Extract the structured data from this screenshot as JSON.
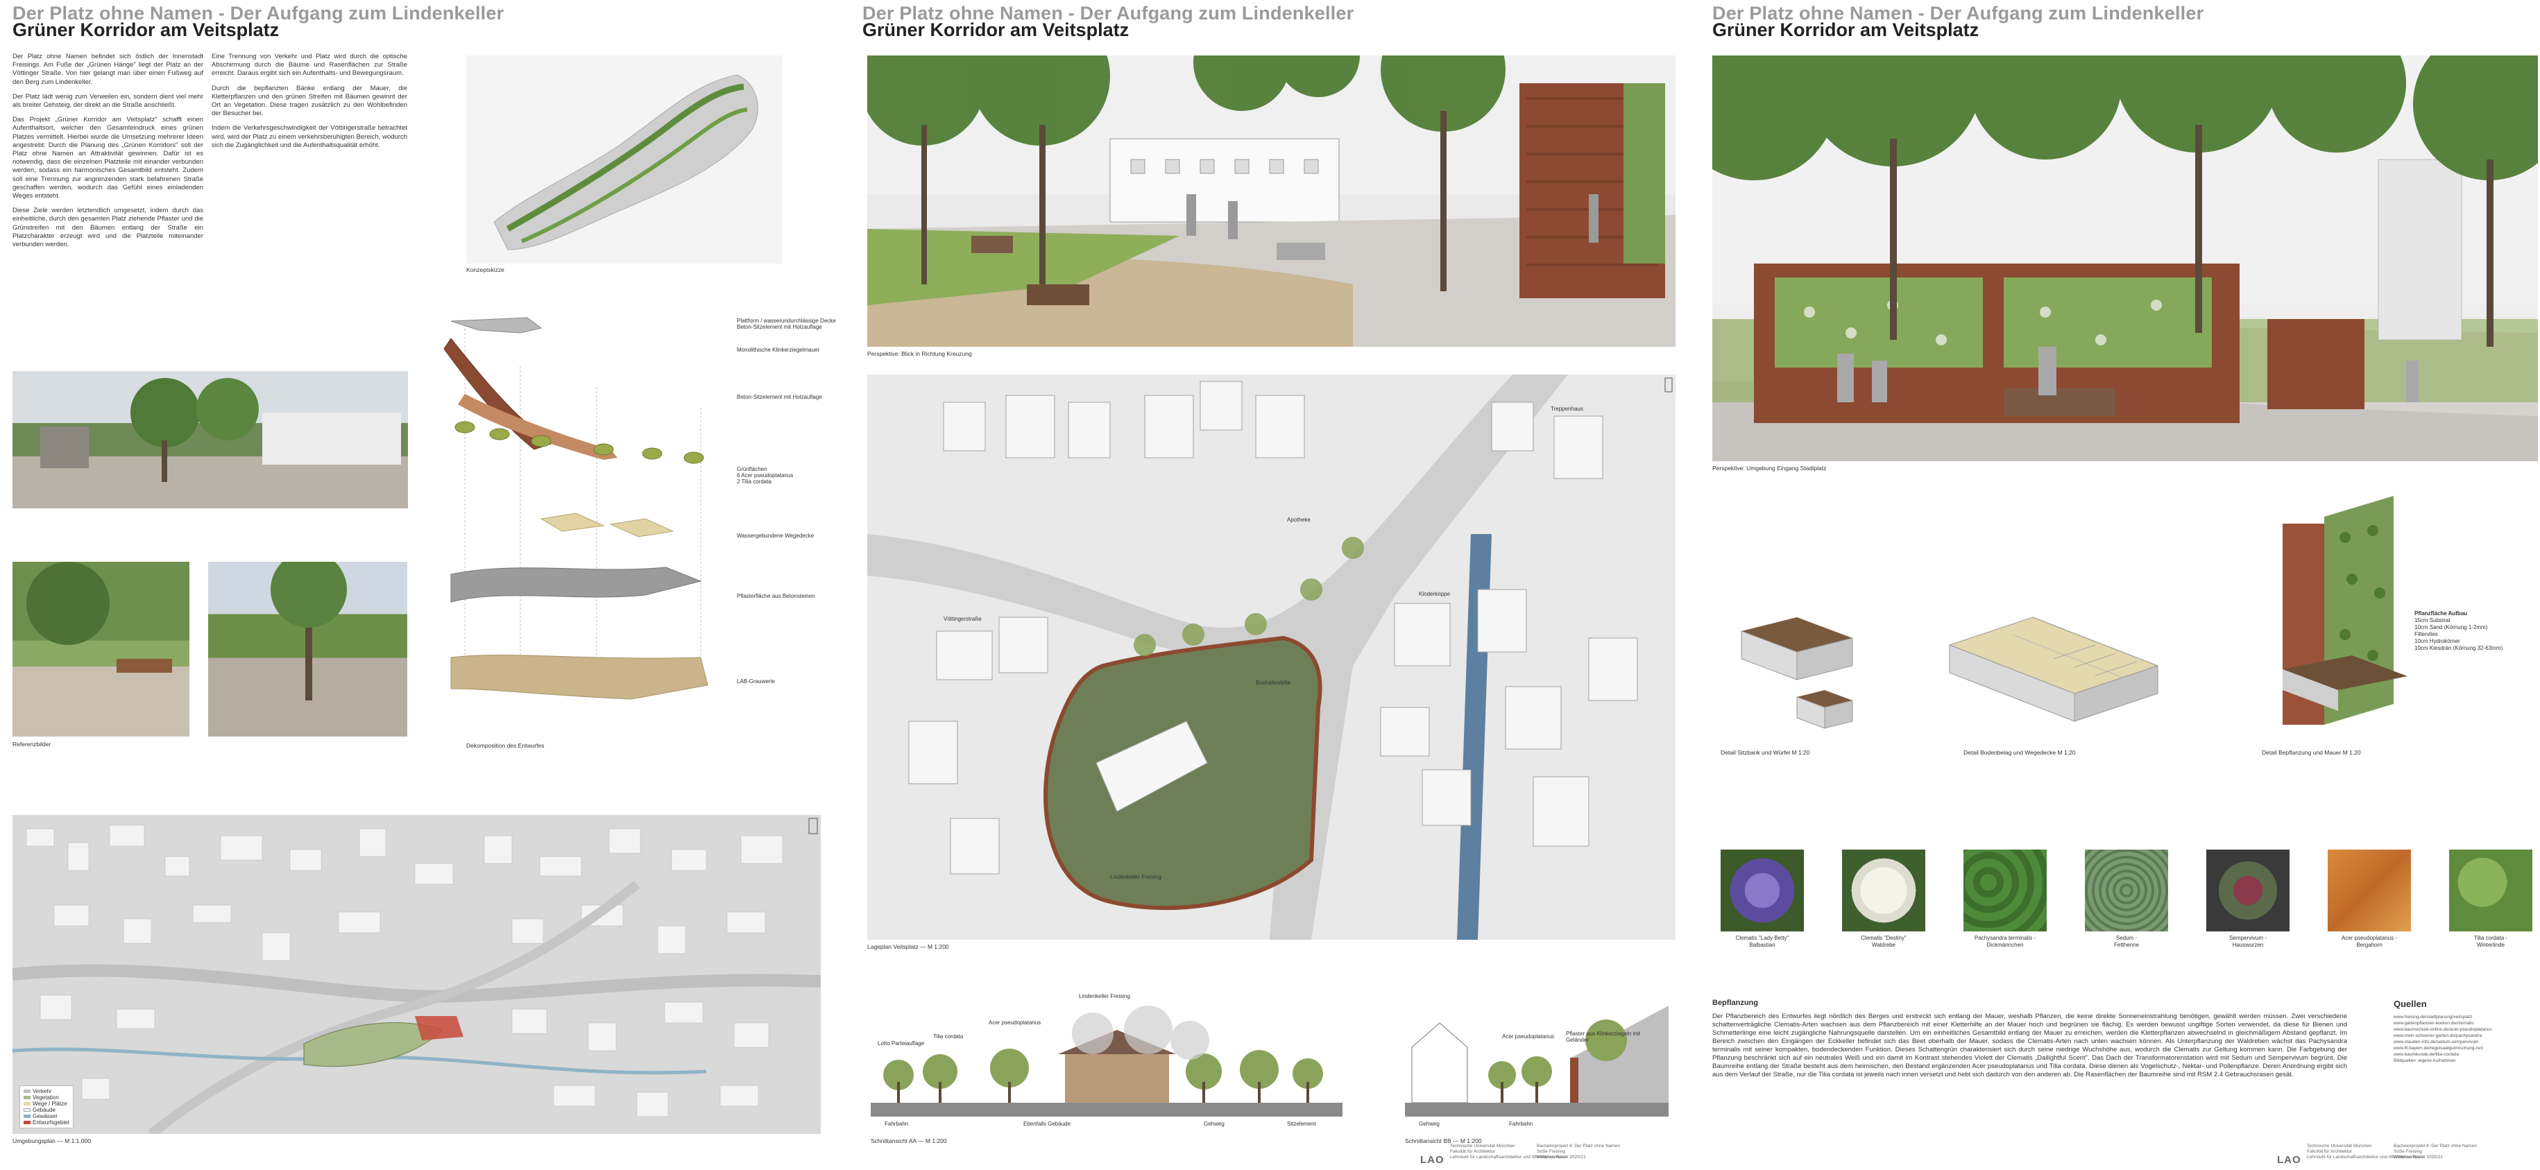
{
  "sheets": [
    {
      "title_line1": "Der Platz ohne Namen - Der Aufgang zum Lindenkeller",
      "title_line2": "Grüner Korridor am Veitsplatz"
    },
    {
      "title_line1": "Der Platz ohne Namen - Der Aufgang zum Lindenkeller",
      "title_line2": "Grüner Korridor am Veitsplatz"
    },
    {
      "title_line1": "Der Platz ohne Namen - Der Aufgang zum Lindenkeller",
      "title_line2": "Grüner Korridor am Veitsplatz"
    }
  ],
  "sheet1": {
    "intro_col1": [
      "Der Platz ohne Namen befindet sich östlich der Innenstadt Freisings. Am Fuße der „Grünen Hänge\" liegt der Platz an der Vöttinger Straße. Von hier gelangt man über einen Fußweg auf den Berg zum Lindenkeller.",
      "Der Platz lädt wenig zum Verweilen ein, sondern dient viel mehr als breiter Gehsteig, der direkt an die Straße anschließt.",
      "Das Projekt „Grüner Korridor am Veitsplatz\" schafft einen Aufenthaltsort, welcher den Gesamteindruck eines grünen Platzes vermittelt. Hierbei wurde die Umsetzung mehrerer Ideen angestrebt: Durch die Planung des „Grünen Korridors\" soll der Platz ohne Namen an Attraktivität gewinnen. Dafür ist es notwendig, dass die einzelnen Platzteile mit einander verbunden werden, sodass ein harmonisches Gesamtbild entsteht. Zudem soll eine Trennung zur angrenzenden stark befahrenen Straße geschaffen werden, wodurch das Gefühl eines einladenden Weges entsteht.",
      "Diese Ziele werden letztendlich umgesetzt, indem durch das einheitliche, durch den gesamten Platz ziehende Pflaster und die Grünstreifen mit den Bäumen entlang der Straße ein Platzcharakter erzeugt wird und die Platzteile miteinander verbunden werden."
    ],
    "intro_col2": [
      "Eine Trennung von Verkehr und Platz wird durch die optische Abschirmung durch die Bäume und Rasenflächen zur Straße erreicht. Daraus ergibt sich ein Aufenthalts- und Bewegungsraum.",
      "Durch die bepflanzten Bänke entlang der Mauer, die Kletterpflanzen und den grünen Streifen mit Bäumen gewinnt der Ort an Vegetation. Diese tragen zusätzlich zu den Wohlbefinden der Besucher bei.",
      "Indem die Verkehrsgeschwindigkeit der Vöttingerstraße betrachtet wird, wird der Platz zu einem verkehrsberuhigten Bereich, wodurch sich die Zugänglichkeit und die Aufenthaltsqualität erhöht."
    ],
    "concept_caption": "Konzeptskizze",
    "reference_caption": "Referenzbilder",
    "decomposition_caption": "Dekomposition des Entwurfes",
    "environment_caption": "Umgebungsplan — M 1:1.000",
    "explode_labels": [
      "Plattform / wasserundurchlässige Decke\nBeton-Sitzelement mit Holzauflage",
      "Monolithische Klinkerziegelmauer",
      "Beton-Sitzelement mit Holzauflage",
      "Grünflächen\n6 Acer pseudoplatanus\n2 Tilia cordata",
      "Wassergebundene Wegedecke",
      "Pflasterfläche aus Betonsteinen",
      "LAB-Grauwerte"
    ],
    "legend": [
      "Verkehr",
      "Vegetation",
      "Wege / Plätze",
      "Gebäude",
      "Gewässer",
      "Entwurfsgebiet"
    ]
  },
  "sheet2": {
    "perspective_caption": "Perspektive: Blick in Richtung Kreuzung",
    "plan_caption": "Lageplan Veitsplatz — M 1:200",
    "section_a_caption": "Schnittansicht AA — M 1:200",
    "section_b_caption": "Schnittansicht BB — M 1:200",
    "plan_labels": [
      "Vöttingerstraße",
      "Lindenkeller Freising",
      "Bushaltestelle",
      "Treppenhaus",
      "Apotheke",
      "Kinderkrippe"
    ],
    "section_a_labels": [
      "Lindenkeller Freising",
      "Tilia cordata",
      "Acer pseudoplatanus",
      "Lotto Parteiauflage",
      "Ebenfalls Gebäude",
      "Fahrbahn",
      "Gehweg",
      "Sitzelement"
    ],
    "section_b_labels": [
      "Acer pseudoplatanus",
      "Pflaster aus Klinkerziegeln mit Geländer",
      "Gehweg",
      "Fahrbahn"
    ]
  },
  "sheet3": {
    "perspective_caption": "Perspektive: Umgebung Eingang Stadtplatz",
    "detail_captions": [
      "Detail Sitzbank und Würfel M 1:20",
      "Detail Bodenbelag und Wegedecke M 1:20",
      "Detail Bepflanzung und Mauer M 1:20"
    ],
    "wall_layers": [
      "Pflanzfläche Aufbau",
      "15cm Substrat",
      "10cm Sand (Körnung 1-2mm)",
      "Filtervlies",
      "10cm Hydrokörner",
      "10cm Kiesdrän (Körnung 32-63mm)"
    ],
    "plants": [
      {
        "name": "Clematis \"Lady Betty\"\nBalbastian"
      },
      {
        "name": "Clematis \"Destiny\"\nWaldrebe"
      },
      {
        "name": "Pachysandra terminalis -\nDickmännchen"
      },
      {
        "name": "Sedum -\nFetthenne"
      },
      {
        "name": "Sempervivum -\nHauswurzen"
      },
      {
        "name": "Acer pseudoplatanus -\nBergahorn"
      },
      {
        "name": "Tilia cordata -\nWinterlinde"
      }
    ],
    "planting_heading": "Bepflanzung",
    "planting_text": "Der Pflanzbereich des Entwurfes liegt nördlich des Berges und erstreckt sich entlang der Mauer, weshalb Pflanzen, die keine direkte Sonneneinstrahlung benötigen, gewählt werden müssen. Zwei verschiedene schattenverträgliche Clematis-Arten wachsen aus dem Pflanzbereich mit einer Kletterhilfe an der Mauer hoch und begrünen sie flächig. Es werden bewusst ungiftige Sorten verwendet, da diese für Bienen und Schmetterlinge eine leicht zugängliche Nahrungsquelle darstellen. Um ein einheitliches Gesamtbild entlang der Mauer zu erreichen, werden die Kletterpflanzen abwechselnd in gleichmäßigem Abstand gepflanzt. Im Bereich zwischen den Eingängen der Eckkeller befindet sich das Beet oberhalb der Mauer, sodass die Clematis-Arten nach unten wachsen können. Als Unterpflanzung der Waldreben wächst das Pachysandra terminalis mit seiner kompakten, bodendeckenden Funktion. Dieses Schattengrün charakterisiert sich durch seine niedrige Wuchshöhe aus, wodurch die Clematis zur Geltung kommen kann. Die Farbgebung der Pflanzung beschränkt sich auf ein neutrales Weiß und ein damit im Kontrast stehendes Violett der Clematis „Dailightful Scent\". Das Dach der Transformatorenstation wird mit Sedum und Sempervivum begrünt. Die Baumreihe entlang der Straße besteht aus dem heimischen, den Bestand ergänzenden Acer pseudoplatanus und Tilia cordata. Diese dienen als Vogelschutz-, Nektar- und Pollenpflanze. Deren Anordnung ergibt sich aus dem Verlauf der Straße, nur die Tilia cordata ist jeweils nach innen versetzt und hebt sich dadurch von den anderen ab. Die Rasenflächen der Baumreihe sind mit RSM 2.4 Gebrauchsrasen gesät.",
    "sources_heading": "Quellen",
    "sources": [
      "www.freising.de/stadtplanung/veitsplatz",
      "www.gartenpflanzen-lexikon.de/clematis",
      "www.baumschule-online.de/acer-pseudoplatanus",
      "www.mein-schoener-garten.de/pachysandra",
      "www.stauden-info.de/sedum-sempervivum",
      "www.lfl.bayern.de/regelsaatgutmischung-rsm",
      "www.baumkunde.de/tilia-cordata",
      "Bildquellen: eigene Aufnahmen"
    ]
  },
  "footer": {
    "logo": "LAO",
    "institute": "Technische Universität München\nFakultät für Architektur\nLehrstuhl für Landschaftsarchitektur und öffentlichen Raum",
    "course": "Bachelorprojekt 4: Der Platz ohne Namen\nSoSe Freising\nWintersemester 2020/21"
  }
}
